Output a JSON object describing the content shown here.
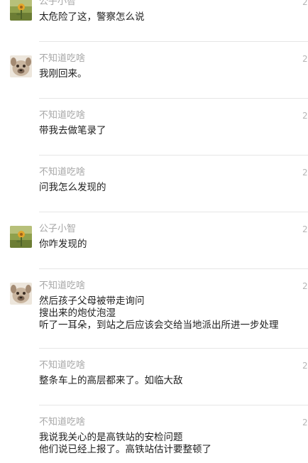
{
  "messages": [
    {
      "sender": "公子小智",
      "time": "2",
      "avatar": "avatar-flower",
      "lines": [
        "太危险了这，警察怎么说"
      ]
    },
    {
      "sender": "不知道吃啥",
      "time": "2",
      "avatar": "avatar-dog",
      "lines": [
        "我刚回来。"
      ]
    },
    {
      "sender": "不知道吃啥",
      "time": "2",
      "avatar": "",
      "lines": [
        "带我去做笔录了"
      ]
    },
    {
      "sender": "不知道吃啥",
      "time": "2",
      "avatar": "",
      "lines": [
        "问我怎么发现的"
      ]
    },
    {
      "sender": "公子小智",
      "time": "2",
      "avatar": "avatar-flower",
      "lines": [
        "你咋发现的"
      ]
    },
    {
      "sender": "不知道吃啥",
      "time": "2",
      "avatar": "avatar-dog",
      "lines": [
        "然后孩子父母被带走询问",
        "搜出来的炮仗泡湿",
        "听了一耳朵，到站之后应该会交给当地派出所进一步处理"
      ]
    },
    {
      "sender": "不知道吃啥",
      "time": "2",
      "avatar": "",
      "lines": [
        "整条车上的高层都来了。如临大敌"
      ]
    },
    {
      "sender": "不知道吃啥",
      "time": "2",
      "avatar": "",
      "lines": [
        "我说我关心的是高铁站的安检问题",
        "他们说已经上报了。高铁站估计要整顿了"
      ]
    }
  ]
}
